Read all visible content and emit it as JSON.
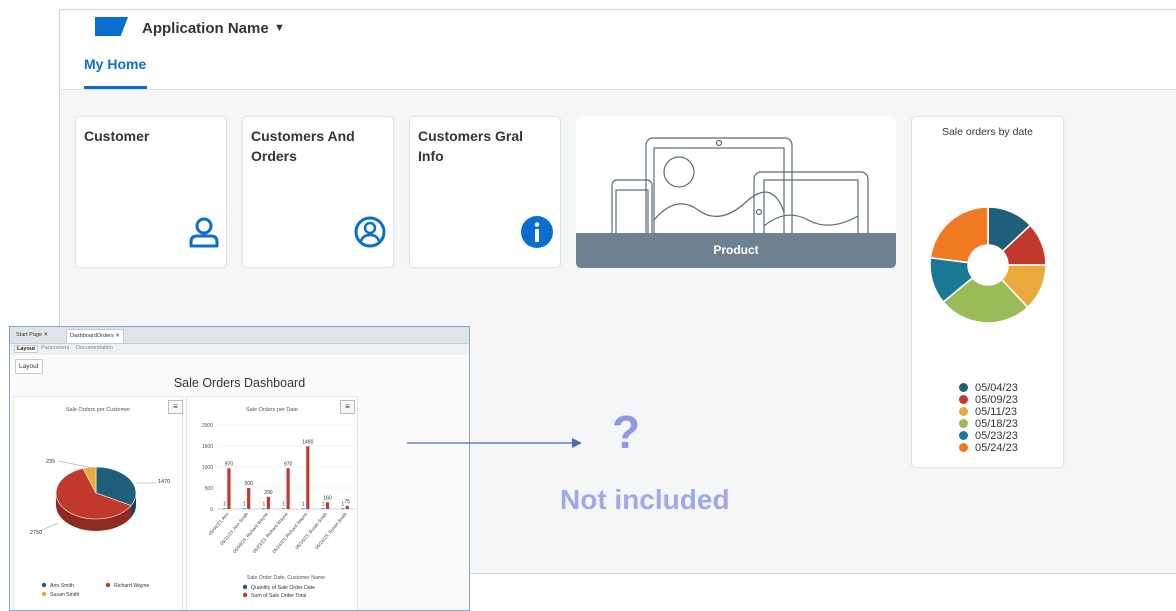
{
  "shell": {
    "app_name": "Application Name",
    "caret": "▼",
    "tabs": [
      {
        "label": "My Home"
      }
    ]
  },
  "tiles": [
    {
      "title": "Customer",
      "icon": "user-icon"
    },
    {
      "title": "Customers And Orders",
      "icon": "user-circle-icon"
    },
    {
      "title": "Customers Gral Info",
      "icon": "info-icon"
    }
  ],
  "product_tile": {
    "label": "Product",
    "icon": "devices-illustration"
  },
  "sale_orders_by_date": {
    "title": "Sale orders by date",
    "legend": [
      {
        "label": "05/04/23",
        "color": "#1f5f7a"
      },
      {
        "label": "05/09/23",
        "color": "#c0392b"
      },
      {
        "label": "05/11/23",
        "color": "#e9a93b"
      },
      {
        "label": "05/18/23",
        "color": "#9bbb59"
      },
      {
        "label": "05/23/23",
        "color": "#1a7a96"
      },
      {
        "label": "05/24/23",
        "color": "#ef7a22"
      }
    ]
  },
  "genexus": {
    "tabs": [
      {
        "label": "Start Page"
      },
      {
        "label": "DashboardOrders"
      }
    ],
    "subtabs": [
      {
        "label": "Layout"
      },
      {
        "label": "Parameters"
      },
      {
        "label": "Documentation"
      }
    ],
    "layout_button": "Layout",
    "dashboard_title": "Sale Orders Dashboard",
    "menu_icon": "≡"
  },
  "chart_data": [
    {
      "type": "pie",
      "title": "",
      "labels": [
        "05/04/23",
        "05/09/23",
        "05/11/23",
        "05/18/23",
        "05/23/23",
        "05/24/23"
      ],
      "values": [
        13,
        12,
        13,
        26,
        13,
        23
      ],
      "colors": [
        "#1f5f7a",
        "#c0392b",
        "#e9a93b",
        "#9bbb59",
        "#1a7a96",
        "#ef7a22"
      ],
      "style": "donut",
      "legend_position": "bottom"
    },
    {
      "type": "pie",
      "title": "Sale Orders per Customer",
      "labels": [
        "Ann Smith",
        "Richard Wayne",
        "Susan Smith"
      ],
      "values": [
        1470,
        2750,
        235
      ],
      "colors": [
        "#1f5f7a",
        "#c0392b",
        "#e9a93b"
      ],
      "data_labels": [
        "1470",
        "2750",
        "235"
      ],
      "legend_position": "bottom"
    },
    {
      "type": "bar",
      "title": "Sale Orders per Date",
      "xlabel": "Sale Order Date, Customer Name",
      "categories": [
        "05/04/23, Ann",
        "05/11/23, Ann Smith",
        "05/09/23, Richard Wayne",
        "05/23/23, Richard Wayne",
        "05/24/23, Richard Wayne",
        "05/18/23, Susan Smith",
        "05/24/23, Susan Smith"
      ],
      "ylim": [
        0,
        2000
      ],
      "yticks": [
        "2000",
        "1500",
        "1000",
        "500",
        "0"
      ],
      "series": [
        {
          "name": "Quantity of Sale Order Date",
          "values": [
            1,
            1,
            1,
            1,
            1,
            1,
            1
          ],
          "color": "#1f5f7a"
        },
        {
          "name": "Sum of Sale Order Total",
          "values": [
            970,
            500,
            290,
            970,
            1490,
            160,
            75
          ],
          "color": "#c0392b"
        }
      ],
      "legend_position": "bottom"
    }
  ],
  "annotation": {
    "question": "?",
    "text": "Not included"
  }
}
